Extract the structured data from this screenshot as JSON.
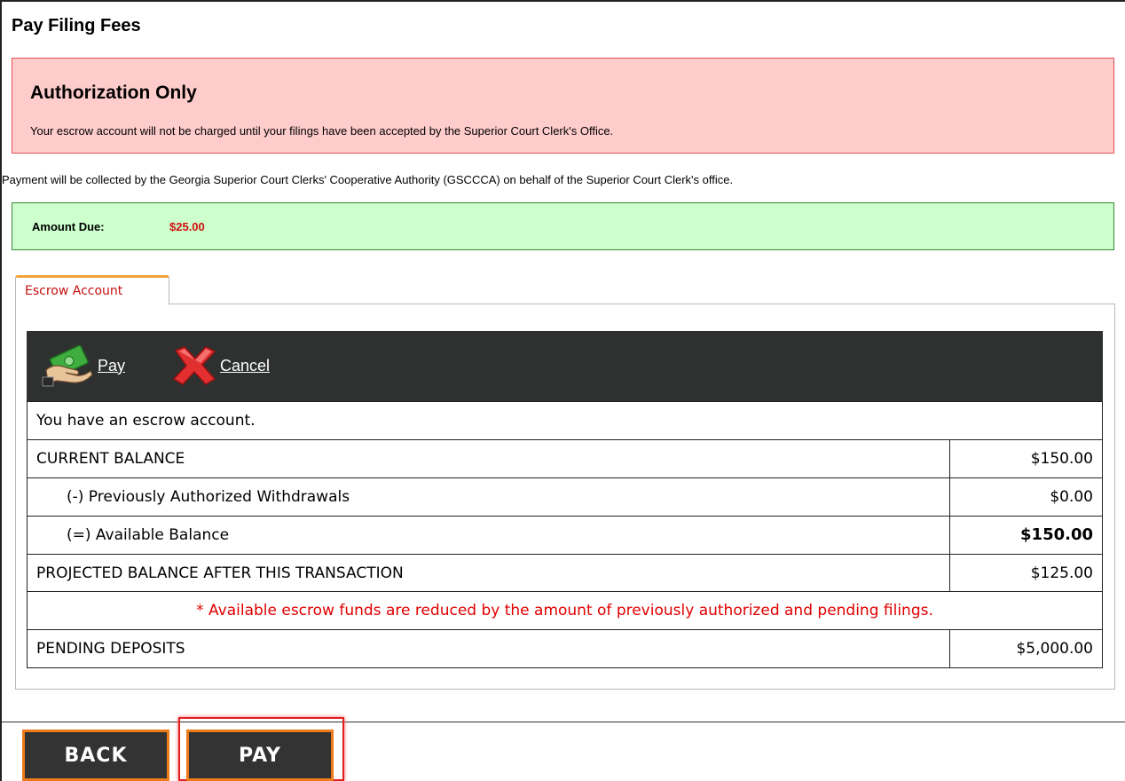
{
  "page": {
    "title": "Pay Filing Fees"
  },
  "authorization": {
    "title": "Authorization Only",
    "text": "Your escrow account will not be charged until your filings have been accepted by the Superior Court Clerk's Office."
  },
  "collection_note": "Payment will be collected by the Georgia Superior Court Clerks' Cooperative Authority (GSCCCA) on behalf of the Superior Court Clerk's office.",
  "amount_due": {
    "label": "Amount Due:",
    "value": "$25.00"
  },
  "tabs": [
    {
      "label": "Escrow Account",
      "active": true
    }
  ],
  "toolbar": {
    "pay_label": "Pay",
    "cancel_label": "Cancel",
    "pay_icon": "money-hand-icon",
    "cancel_icon": "red-x-icon"
  },
  "escrow": {
    "intro": "You have an escrow account.",
    "rows": [
      {
        "label": "CURRENT BALANCE",
        "value": "$150.00"
      },
      {
        "label": "(-) Previously Authorized Withdrawals",
        "value": "$0.00"
      },
      {
        "label": "(=) Available Balance",
        "value": "$150.00"
      },
      {
        "label": "PROJECTED BALANCE AFTER THIS TRANSACTION",
        "value": "$125.00"
      }
    ],
    "notice": "* Available escrow funds are reduced by the amount of previously authorized and pending filings.",
    "pending": {
      "label": "PENDING DEPOSITS",
      "value": "$5,000.00"
    }
  },
  "actions": {
    "back_label": "BACK",
    "pay_label": "PAY"
  },
  "colors": {
    "auth_bg": "#ffcccc",
    "amount_bg": "#ccffcc",
    "amount_value": "#d01010",
    "toolbar_bg": "#2e3130",
    "button_border": "#ee7a1a",
    "notice": "#e00000"
  }
}
